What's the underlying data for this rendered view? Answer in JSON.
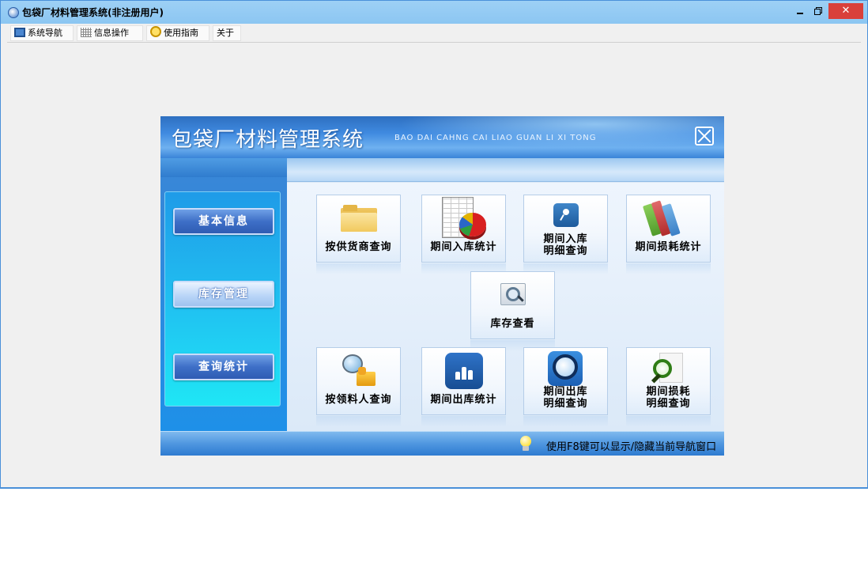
{
  "window": {
    "title": "包袋厂材料管理系统(非注册用户)",
    "controls": {
      "minimize": "–",
      "restore": "□",
      "close": "✕"
    }
  },
  "menubar": {
    "items": [
      {
        "label": "系统导航",
        "icon": "navigation-icon"
      },
      {
        "label": "信息操作",
        "icon": "grid-icon"
      },
      {
        "label": "使用指南",
        "icon": "help-icon"
      },
      {
        "label": "关于",
        "icon": ""
      }
    ]
  },
  "nav_panel": {
    "title": "包袋厂材料管理系统",
    "subtitle": "BAO DAI CAHNG CAI LIAO GUAN LI XI TONG",
    "close_icon": "close-icon",
    "sidebar": {
      "items": [
        {
          "label": "基本信息",
          "active": false
        },
        {
          "label": "库存管理",
          "active": true
        },
        {
          "label": "查询统计",
          "active": false
        }
      ]
    },
    "tiles": [
      {
        "label": "按供货商查询",
        "icon": "folder-icon"
      },
      {
        "label": "期间入库统计",
        "icon": "spreadsheet-pie-icon"
      },
      {
        "label_line1": "期间入库",
        "label_line2": "明细查询",
        "icon": "key-search-icon"
      },
      {
        "label": "期间损耗统计",
        "icon": "books-chart-icon"
      },
      {
        "label": "库存查看",
        "icon": "zoom-icon"
      },
      {
        "label": "按领料人查询",
        "icon": "person-search-icon"
      },
      {
        "label": "期间出库统计",
        "icon": "bar-chart-icon"
      },
      {
        "label_line1": "期间出库",
        "label_line2": "明细查询",
        "icon": "magnifier-icon"
      },
      {
        "label_line1": "期间损耗",
        "label_line2": "明细查询",
        "icon": "document-search-icon"
      }
    ],
    "status_text": "使用F8键可以显示/隐藏当前导航窗口"
  },
  "colors": {
    "title_bar": "#8cc6f2",
    "close_button": "#d9403b",
    "panel_header": "#3f8ae0",
    "sidebar": "#20c6f2"
  }
}
